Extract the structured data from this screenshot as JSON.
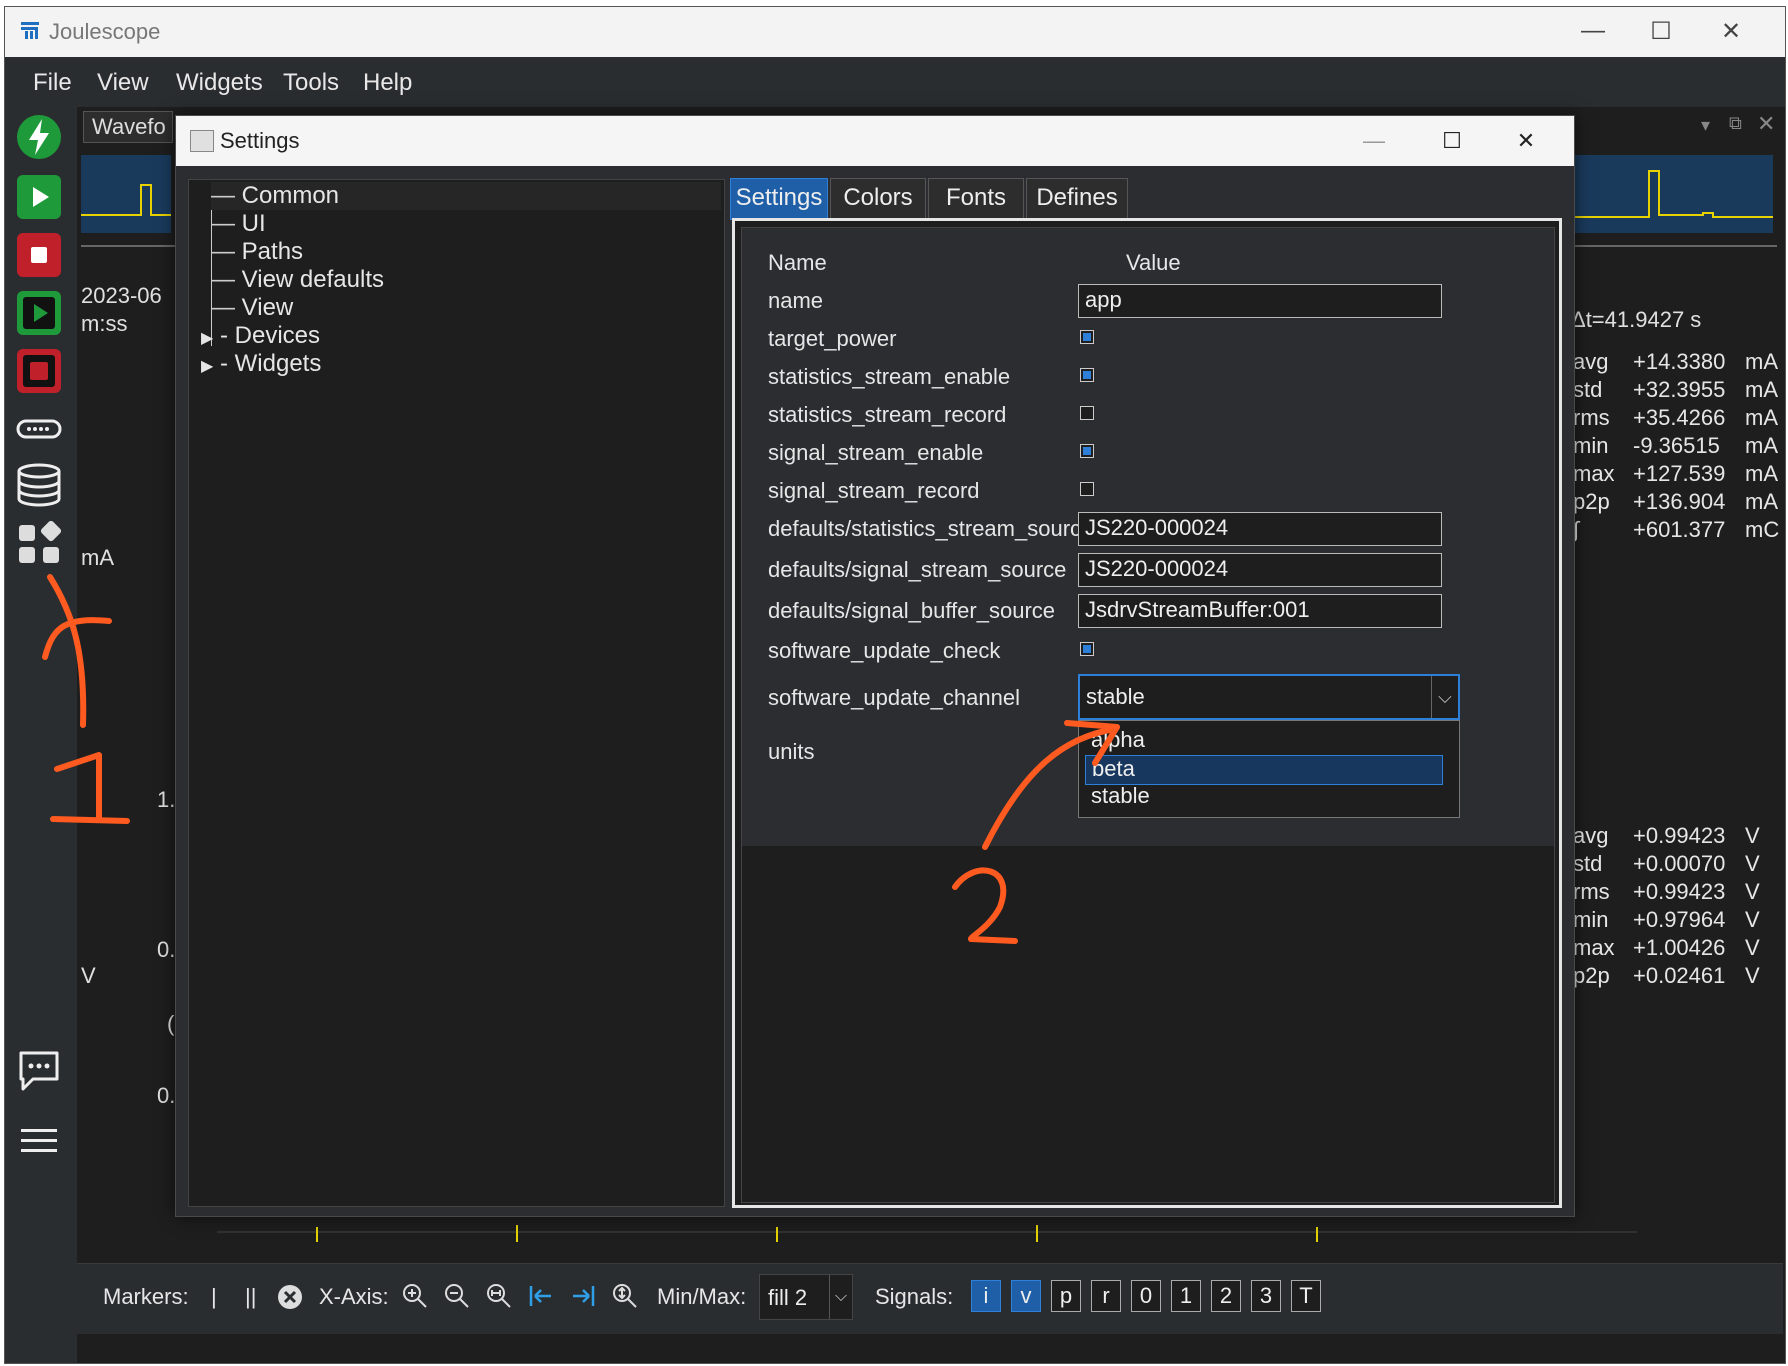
{
  "app": {
    "title": "Joulescope",
    "accent": "#2e7fd8",
    "annotation_color": "#ff5a1f"
  },
  "menu": [
    "File",
    "View",
    "Widgets",
    "Tools",
    "Help"
  ],
  "left_toolbar": [
    "power-icon",
    "play-icon",
    "stop-icon",
    "play-record-icon",
    "stop-record-icon",
    "device-icon",
    "database-icon",
    "widgets-icon",
    "chat-icon",
    "hamburger-icon"
  ],
  "workspace": {
    "tab_label": "Wavefo",
    "time_label_a": "2023-06",
    "time_label_b": "m:ss",
    "current_unit": "mA",
    "voltage_unit": "V",
    "y_ticks": [
      "1.",
      "0.",
      "(",
      "0."
    ],
    "delta_t": "Δt=41.9427 s",
    "current_stats": [
      {
        "k": "avg",
        "v": "+14.3380",
        "u": "mA"
      },
      {
        "k": "std",
        "v": "+32.3955",
        "u": "mA"
      },
      {
        "k": "rms",
        "v": "+35.4266",
        "u": "mA"
      },
      {
        "k": "min",
        "v": "-9.36515",
        "u": "mA"
      },
      {
        "k": "max",
        "v": "+127.539",
        "u": "mA"
      },
      {
        "k": "p2p",
        "v": "+136.904",
        "u": "mA"
      },
      {
        "k": "∫",
        "v": "+601.377",
        "u": "mC"
      }
    ],
    "voltage_stats": [
      {
        "k": "avg",
        "v": "+0.99423",
        "u": "V"
      },
      {
        "k": "std",
        "v": "+0.00070",
        "u": "V"
      },
      {
        "k": "rms",
        "v": "+0.99423",
        "u": "V"
      },
      {
        "k": "min",
        "v": "+0.97964",
        "u": "V"
      },
      {
        "k": "max",
        "v": "+1.00426",
        "u": "V"
      },
      {
        "k": "p2p",
        "v": "+0.02461",
        "u": "V"
      }
    ]
  },
  "bottom_bar": {
    "markers_label": "Markers:",
    "single_marker": "|",
    "dual_marker": "||",
    "xaxis_label": "X-Axis:",
    "minmax_label": "Min/Max:",
    "minmax_value": "fill 2",
    "signals_label": "Signals:",
    "signals": [
      {
        "label": "i",
        "on": true
      },
      {
        "label": "v",
        "on": true
      },
      {
        "label": "p",
        "on": false
      },
      {
        "label": "r",
        "on": false
      },
      {
        "label": "0",
        "on": false
      },
      {
        "label": "1",
        "on": false
      },
      {
        "label": "2",
        "on": false
      },
      {
        "label": "3",
        "on": false
      },
      {
        "label": "T",
        "on": false
      }
    ]
  },
  "dialog": {
    "title": "Settings",
    "tree": [
      "Common",
      "UI",
      "Paths",
      "View defaults",
      "View",
      "Devices",
      "Widgets"
    ],
    "tabs": [
      "Settings",
      "Colors",
      "Fonts",
      "Defines"
    ],
    "active_tab": "Settings",
    "header_name": "Name",
    "header_value": "Value",
    "rows": {
      "name": {
        "label": "name",
        "value": "app"
      },
      "target_power": {
        "label": "target_power",
        "checked": true
      },
      "stats_enable": {
        "label": "statistics_stream_enable",
        "checked": true
      },
      "stats_record": {
        "label": "statistics_stream_record",
        "checked": false
      },
      "signal_enable": {
        "label": "signal_stream_enable",
        "checked": true
      },
      "signal_record": {
        "label": "signal_stream_record",
        "checked": false
      },
      "stats_source": {
        "label": "defaults/statistics_stream_source",
        "value": "JS220-000024"
      },
      "signal_source": {
        "label": "defaults/signal_stream_source",
        "value": "JS220-000024"
      },
      "buffer_source": {
        "label": "defaults/signal_buffer_source",
        "value": "JsdrvStreamBuffer:001"
      },
      "update_check": {
        "label": "software_update_check",
        "checked": true
      },
      "update_channel": {
        "label": "software_update_channel",
        "value": "stable"
      },
      "units": {
        "label": "units"
      }
    },
    "dropdown_options": [
      "alpha",
      "beta",
      "stable"
    ],
    "highlighted_option": "beta"
  }
}
